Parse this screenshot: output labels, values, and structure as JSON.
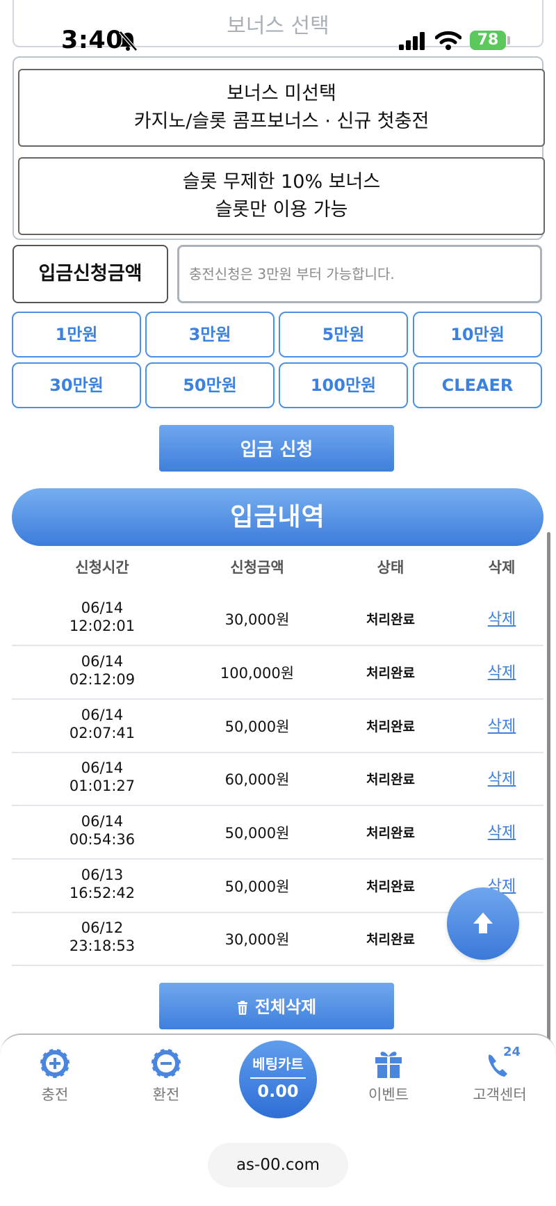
{
  "status_bar": {
    "time": "3:40",
    "battery": "78"
  },
  "bonus": {
    "header": "보너스 선택",
    "options": [
      {
        "line1": "보너스 미선택",
        "line2": "카지노/슬롯 콤프보너스 · 신규 첫충전"
      },
      {
        "line1": "슬롯 무제한 10% 보너스",
        "line2": "슬롯만 이용 가능"
      }
    ]
  },
  "deposit": {
    "label": "입금신청금액",
    "placeholder": "충전신청은 3만원 부터 가능합니다.",
    "amounts": [
      "1만원",
      "3만원",
      "5만원",
      "10만원",
      "30만원",
      "50만원",
      "100만원",
      "CLEAER"
    ],
    "submit_label": "입금 신청"
  },
  "history": {
    "title": "입금내역",
    "columns": [
      "신청시간",
      "신청금액",
      "상태",
      "삭제"
    ],
    "rows": [
      {
        "date": "06/14",
        "time": "12:02:01",
        "amount": "30,000원",
        "status": "처리완료",
        "delete": "삭제"
      },
      {
        "date": "06/14",
        "time": "02:12:09",
        "amount": "100,000원",
        "status": "처리완료",
        "delete": "삭제"
      },
      {
        "date": "06/14",
        "time": "02:07:41",
        "amount": "50,000원",
        "status": "처리완료",
        "delete": "삭제"
      },
      {
        "date": "06/14",
        "time": "01:01:27",
        "amount": "60,000원",
        "status": "처리완료",
        "delete": "삭제"
      },
      {
        "date": "06/14",
        "time": "00:54:36",
        "amount": "50,000원",
        "status": "처리완료",
        "delete": "삭제"
      },
      {
        "date": "06/13",
        "time": "16:52:42",
        "amount": "50,000원",
        "status": "처리완료",
        "delete": "삭제"
      },
      {
        "date": "06/12",
        "time": "23:18:53",
        "amount": "30,000원",
        "status": "처리완료",
        "delete": ""
      }
    ],
    "delete_all_label": "전체삭제"
  },
  "nav": {
    "items": [
      {
        "label": "충전",
        "icon": "plus-chip-icon"
      },
      {
        "label": "환전",
        "icon": "minus-chip-icon"
      },
      {
        "label": "이벤트",
        "icon": "gift-icon"
      },
      {
        "label": "고객센터",
        "icon": "phone-24-icon",
        "badge": "24"
      }
    ],
    "cart": {
      "title": "베팅카트",
      "value": "0.00"
    }
  },
  "browser": {
    "url": "as-00.com"
  },
  "colors": {
    "accent": "#3b82e0",
    "accent_light": "#76aef0",
    "battery": "#5ac85a"
  }
}
